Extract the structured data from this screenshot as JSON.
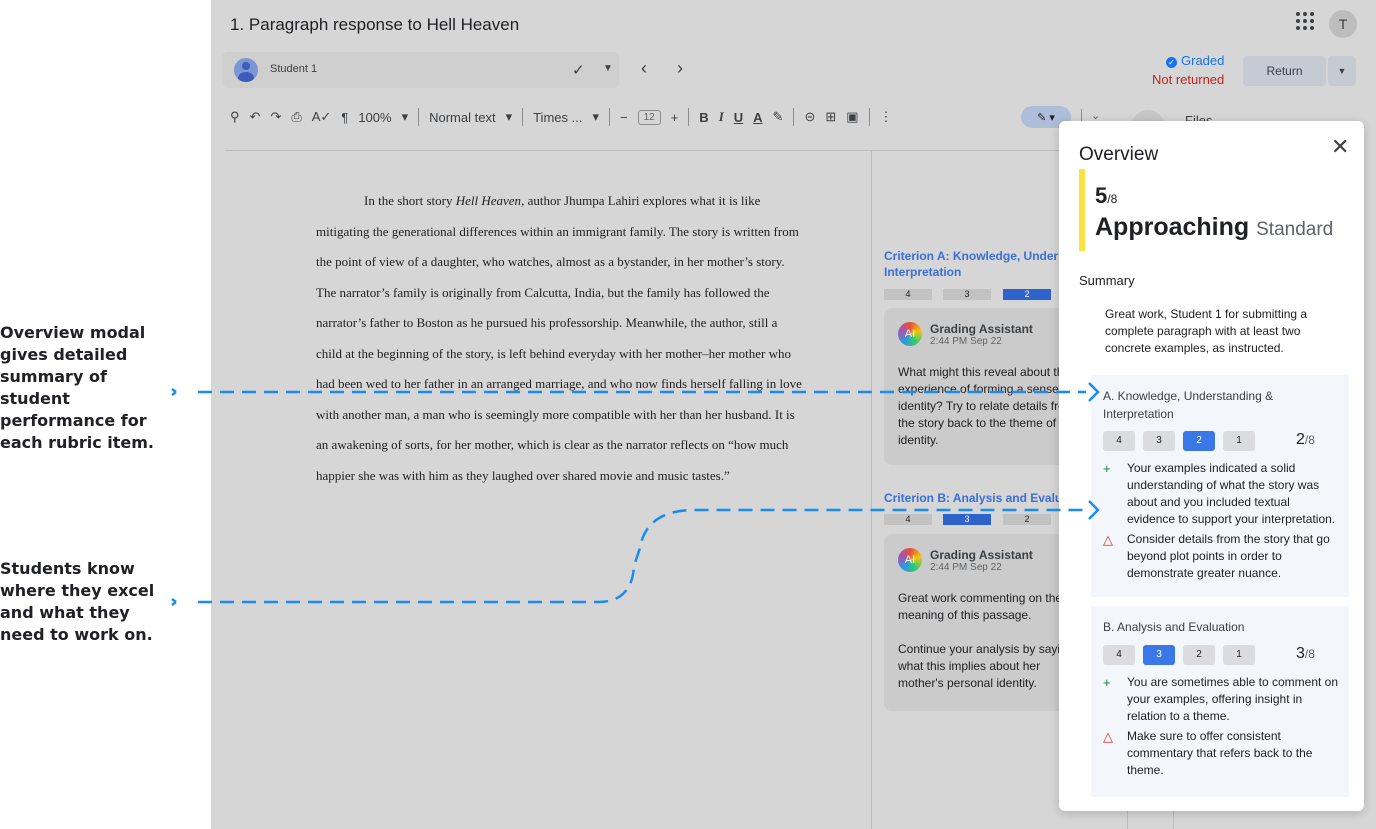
{
  "annotations": {
    "overview": "Overview modal gives detailed summary of student performance for each rubric item.",
    "excel": "Students know where they excel and what they need to work on."
  },
  "header": {
    "title": "1. Paragraph response to Hell Heaven",
    "avatar_letter": "T"
  },
  "student_bar": {
    "name": "Student 1"
  },
  "status": {
    "graded": "Graded",
    "not_returned": "Not returned",
    "return_label": "Return"
  },
  "toolbar": {
    "zoom": "100%",
    "style": "Normal text",
    "font": "Times ...",
    "size": "12",
    "files_label": "Files"
  },
  "document": {
    "paragraph": "In the short story Hell Heaven, author Jhumpa Lahiri explores what it is like mitigating the generational differences within an immigrant family. The story is written from the point of view of a daughter, who watches, almost as a bystander, in her mother’s story. The narrator’s family is originally from Calcutta, India, but the family has followed the narrator’s father to Boston as he pursued his professorship. Meanwhile, the author, still a child at the beginning of the story, is left behind everyday with her mother–her mother who had been wed to her father in an arranged marriage, and who now finds herself falling in love with another man, a man who is seemingly more compatible with her than her husband. It is an awakening of sorts, for her mother, which is clear as the narrator reflects on “how much happier she was with him as they laughed over shared movie and music tastes.”",
    "pre": "In the short story ",
    "book_title": "Hell Heaven",
    "post": ", author Jhumpa Lahiri explores what it is like mitigating the generational differences within an immigrant family. The story is written from the point of view of a daughter, who watches, almost as a bystander, in her mother’s story. The narrator’s family is originally from Calcutta, India, but the family has followed the narrator’s father to Boston as he pursued his professorship. Meanwhile, the author, still a child at the beginning of the story, is left behind everyday with her mother–her mother who had been wed to her father in an arranged marriage, and who now finds herself falling in love with another man, a man who is seemingly more compatible with her than her husband. It is an awakening of sorts, for her mother, which is clear as the narrator reflects on “how much happier she was with him as they laughed over shared movie and music tastes.”"
  },
  "criteria": [
    {
      "title_line1": "Criterion A: Knowledge, Understa",
      "title_line2": "Interpretation",
      "scores": [
        "4",
        "3",
        "2"
      ],
      "selected": "2",
      "assistant": "Grading Assistant",
      "time": "2:44 PM Sep 22",
      "comment_lines": [
        "What might this reveal about th",
        "experience of forming a sense",
        "identity? Try to relate details fro",
        "the story back to the theme of",
        "identity."
      ]
    },
    {
      "title_line1": "Criterion B: Analysis and Evaluati",
      "scores": [
        "4",
        "3",
        "2"
      ],
      "selected": "3",
      "assistant": "Grading Assistant",
      "time": "2:44 PM Sep 22",
      "comment_lines_1": [
        "Great work commenting on the",
        "meaning of this passage."
      ],
      "comment_lines_2": [
        "Continue your analysis by sayin",
        "what this implies about her",
        "mother's personal identity."
      ]
    }
  ],
  "overview": {
    "title": "Overview",
    "score": "5",
    "score_total": "/8",
    "level": "Approaching",
    "level_suffix": "Standard",
    "summary_label": "Summary",
    "summary_text": "Great work, Student 1 for submitting a complete paragraph with at least two concrete examples, as instructed.",
    "rubric": [
      {
        "title": "A. Knowledge, Understanding & Interpretation",
        "options": [
          "4",
          "3",
          "2",
          "1"
        ],
        "selected": "2",
        "score": "2",
        "score_total": "/8",
        "strength": "Your examples indicated a solid understanding of what the story was about and you included textual evidence to support your interpretation.",
        "improve": "Consider details from the story that go beyond plot points in order to demonstrate greater nuance."
      },
      {
        "title": "B. Analysis and Evaluation",
        "options": [
          "4",
          "3",
          "2",
          "1"
        ],
        "selected": "3",
        "score": "3",
        "score_total": "/8",
        "strength": "You are sometimes able to comment on your examples, offering insight in relation to a theme.",
        "improve": "Make sure to offer consistent commentary that refers back to the theme."
      }
    ]
  },
  "colors": {
    "accent": "#1a73e8",
    "selected_score": "#3b78e7",
    "warning": "#d93025",
    "positive": "#188038",
    "level_bar": "#f7e443",
    "connector": "#1a8cf0"
  }
}
